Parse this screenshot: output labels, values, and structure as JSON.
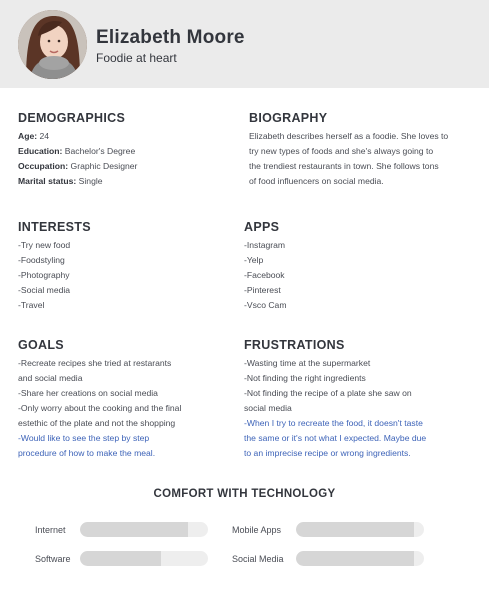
{
  "profile": {
    "name": "Elizabeth Moore",
    "tagline": "Foodie at heart"
  },
  "demographics": {
    "title": "DEMOGRAPHICS",
    "fields": [
      {
        "label": "Age:",
        "value": "24"
      },
      {
        "label": "Education:",
        "value": "Bachelor's Degree"
      },
      {
        "label": "Occupation:",
        "value": "Graphic Designer"
      },
      {
        "label": "Marital status:",
        "value": "Single"
      }
    ]
  },
  "biography": {
    "title": "BIOGRAPHY",
    "lines": [
      "Elizabeth describes herself as a foodie. She loves to",
      "try new types of foods and she's always going to",
      "the trendiest restaurants in town. She follows tons",
      "of food influencers on social media."
    ]
  },
  "interests": {
    "title": "INTERESTS",
    "items": [
      "-Try new food",
      "-Foodstyling",
      "-Photography",
      "-Social media",
      "-Travel"
    ]
  },
  "apps": {
    "title": "APPS",
    "items": [
      "-Instagram",
      "-Yelp",
      "-Facebook",
      "-Pinterest",
      "-Vsco Cam"
    ]
  },
  "goals": {
    "title": "GOALS",
    "lines": [
      "-Recreate recipes she tried at restarants",
      "and social media",
      "-Share her creations on social media",
      "-Only worry about the cooking and the final",
      "estethic of the plate and not the shopping",
      "-Would like to see the step by step",
      "procedure of how to make the meal."
    ]
  },
  "frustrations": {
    "title": "FRUSTRATIONS",
    "lines": [
      "-Wasting time at the supermarket",
      "-Not finding the right ingredients",
      "-Not finding the recipe of a plate she saw on",
      "social media",
      "-When I try to recreate the food, it doesn't taste",
      "the same or it's not what I expected. Maybe due",
      "to an imprecise recipe or wrong ingredients."
    ]
  },
  "technology": {
    "title": "COMFORT WITH TECHNOLOGY",
    "bars": [
      {
        "label": "Internet",
        "level": 0.84
      },
      {
        "label": "Software",
        "level": 0.63
      },
      {
        "label": "Mobile Apps",
        "level": 0.92
      },
      {
        "label": "Social Media",
        "level": 0.92
      }
    ]
  },
  "colors": {
    "header_bg": "#ebebeb",
    "accent_blue": "#3d63b8",
    "bar_fill": "#d6d6d6",
    "bar_track": "#eeeeee"
  }
}
